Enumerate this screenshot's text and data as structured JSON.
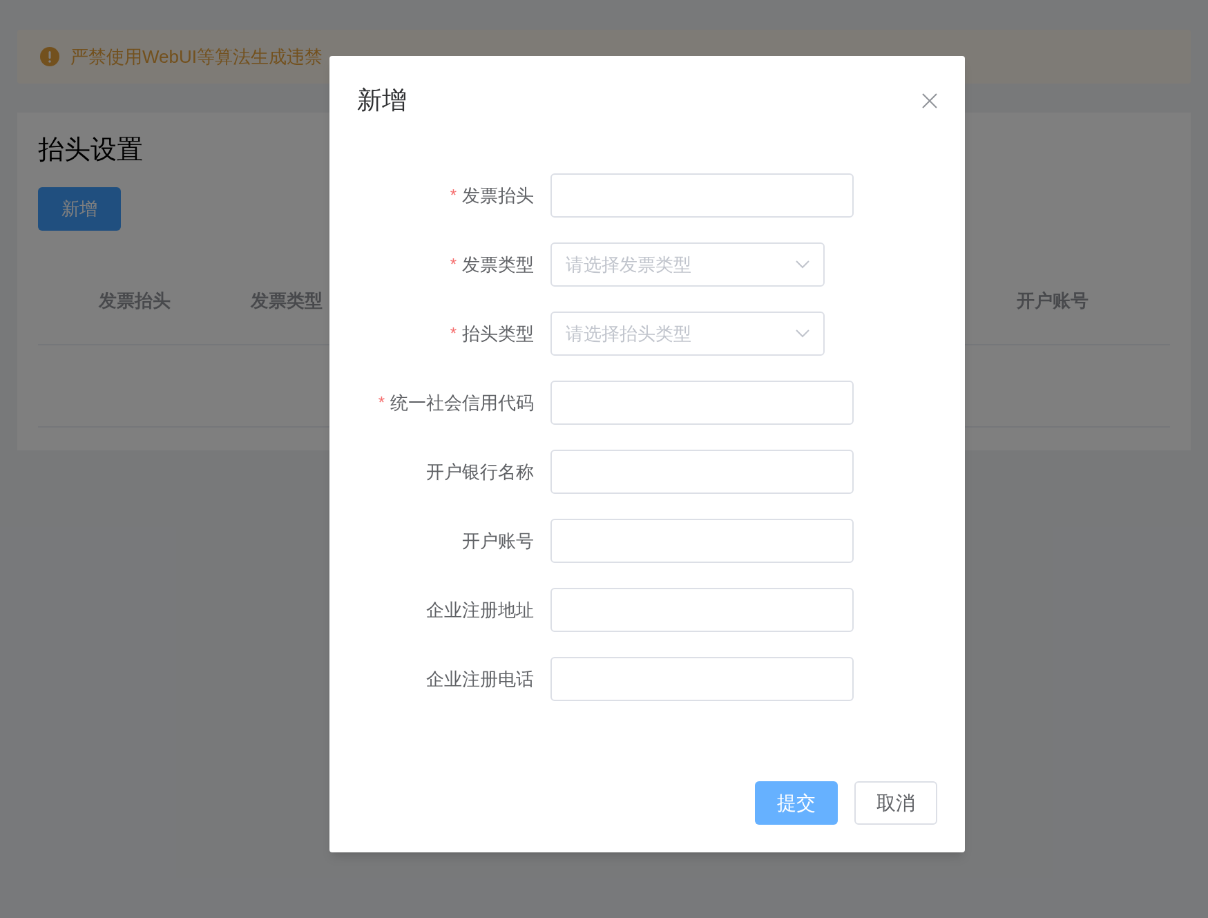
{
  "notice": {
    "text": "严禁使用WebUI等算法生成违禁"
  },
  "page": {
    "title": "抬头设置",
    "add_button": "新增"
  },
  "table": {
    "columns": [
      "发票抬头",
      "发票类型",
      "开户账号"
    ]
  },
  "dialog": {
    "title": "新增",
    "fields": [
      {
        "label": "发票抬头",
        "required_mark": "*",
        "kind": "text"
      },
      {
        "label": "发票类型",
        "required_mark": "*",
        "kind": "select",
        "placeholder": "请选择发票类型"
      },
      {
        "label": "抬头类型",
        "required_mark": "*",
        "kind": "select",
        "placeholder": "请选择抬头类型"
      },
      {
        "label": "统一社会信用代码",
        "required_mark": "*",
        "kind": "text"
      },
      {
        "label": "开户银行名称",
        "kind": "text"
      },
      {
        "label": "开户账号",
        "kind": "text"
      },
      {
        "label": "企业注册地址",
        "kind": "text"
      },
      {
        "label": "企业注册电话",
        "kind": "text"
      }
    ],
    "buttons": [
      {
        "label": "提交",
        "kind": "primary"
      },
      {
        "label": "取消",
        "kind": "default"
      }
    ]
  }
}
